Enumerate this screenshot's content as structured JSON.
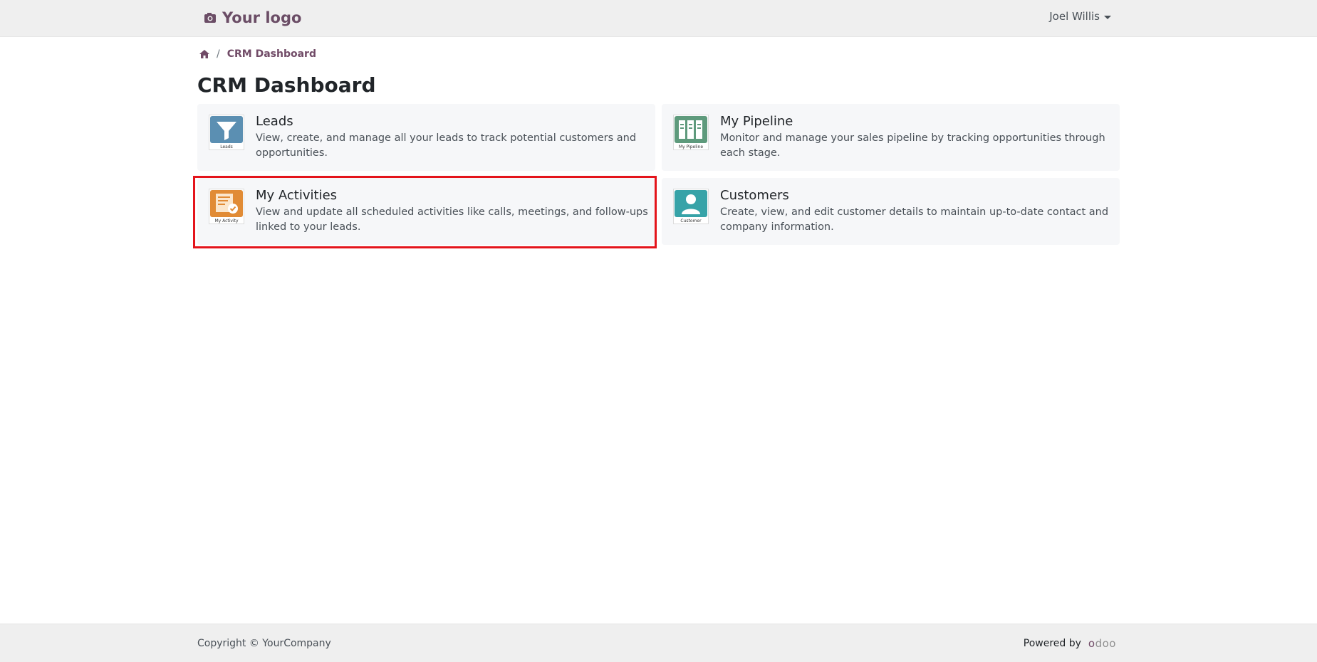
{
  "header": {
    "logo_text": "Your logo",
    "user_name": "Joel Willis"
  },
  "breadcrumb": {
    "current": "CRM Dashboard"
  },
  "page_title": "CRM Dashboard",
  "cards": [
    {
      "title": "Leads",
      "description": "View, create, and manage all your leads to track potential customers and opportunities.",
      "icon_label": "Leads",
      "icon_color": "#5b8fb2"
    },
    {
      "title": "My Pipeline",
      "description": "Monitor and manage your sales pipeline by tracking opportunities through each stage.",
      "icon_label": "My Pipeline",
      "icon_color": "#5e9a7c"
    },
    {
      "title": "My Activities",
      "description": "View and update all scheduled activities like calls, meetings, and follow-ups linked to your leads.",
      "icon_label": "My Activity",
      "icon_color": "#e18b35"
    },
    {
      "title": "Customers",
      "description": "Create, view, and edit customer details to maintain up-to-date contact and company information.",
      "icon_label": "Customer",
      "icon_color": "#37a3a8"
    }
  ],
  "footer": {
    "copyright": "Copyright © YourCompany",
    "powered_by": "Powered by",
    "brand": "odoo"
  },
  "colors": {
    "accent": "#714b67",
    "highlight": "#e4141b"
  }
}
